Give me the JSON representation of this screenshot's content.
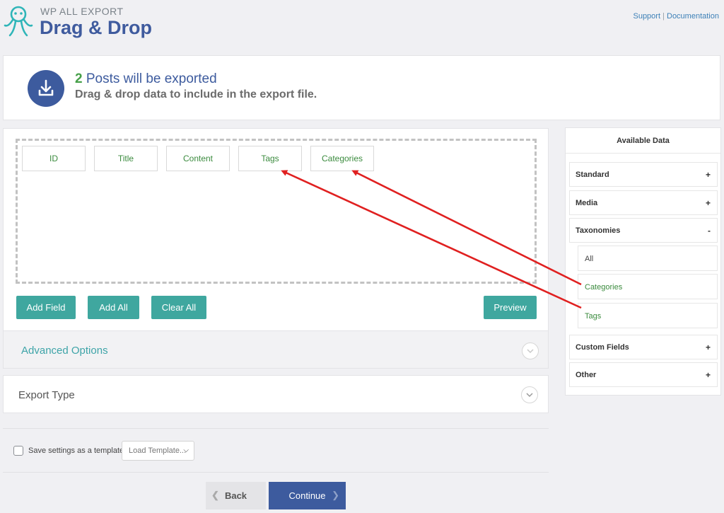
{
  "header": {
    "brand_small": "WP ALL EXPORT",
    "brand_title": "Drag & Drop",
    "links": {
      "support": "Support",
      "separator": "|",
      "documentation": "Documentation"
    }
  },
  "banner": {
    "count": "2",
    "title_rest": "Posts will be exported",
    "subtitle": "Drag & drop data to include in the export file.",
    "icon": "download-icon"
  },
  "fields": [
    "ID",
    "Title",
    "Content",
    "Tags",
    "Categories"
  ],
  "buttons": {
    "add_field": "Add Field",
    "add_all": "Add All",
    "clear_all": "Clear All",
    "preview": "Preview",
    "back": "Back",
    "continue": "Continue"
  },
  "sections": {
    "advanced_options": "Advanced Options",
    "export_type": "Export Type"
  },
  "footer": {
    "save_template": "Save settings as a template",
    "load_template": "Load Template..."
  },
  "sidebar": {
    "title": "Available Data",
    "items": [
      {
        "label": "Standard",
        "sign": "+"
      },
      {
        "label": "Media",
        "sign": "+"
      },
      {
        "label": "Taxonomies",
        "sign": "-"
      },
      {
        "label": "Custom Fields",
        "sign": "+"
      },
      {
        "label": "Other",
        "sign": "+"
      }
    ],
    "taxonomies": [
      "All",
      "Categories",
      "Tags"
    ]
  },
  "colors": {
    "brand_blue": "#3d5b9e",
    "teal": "#3fa79f",
    "green": "#3b8b3e",
    "arrow_red": "#e02020"
  }
}
